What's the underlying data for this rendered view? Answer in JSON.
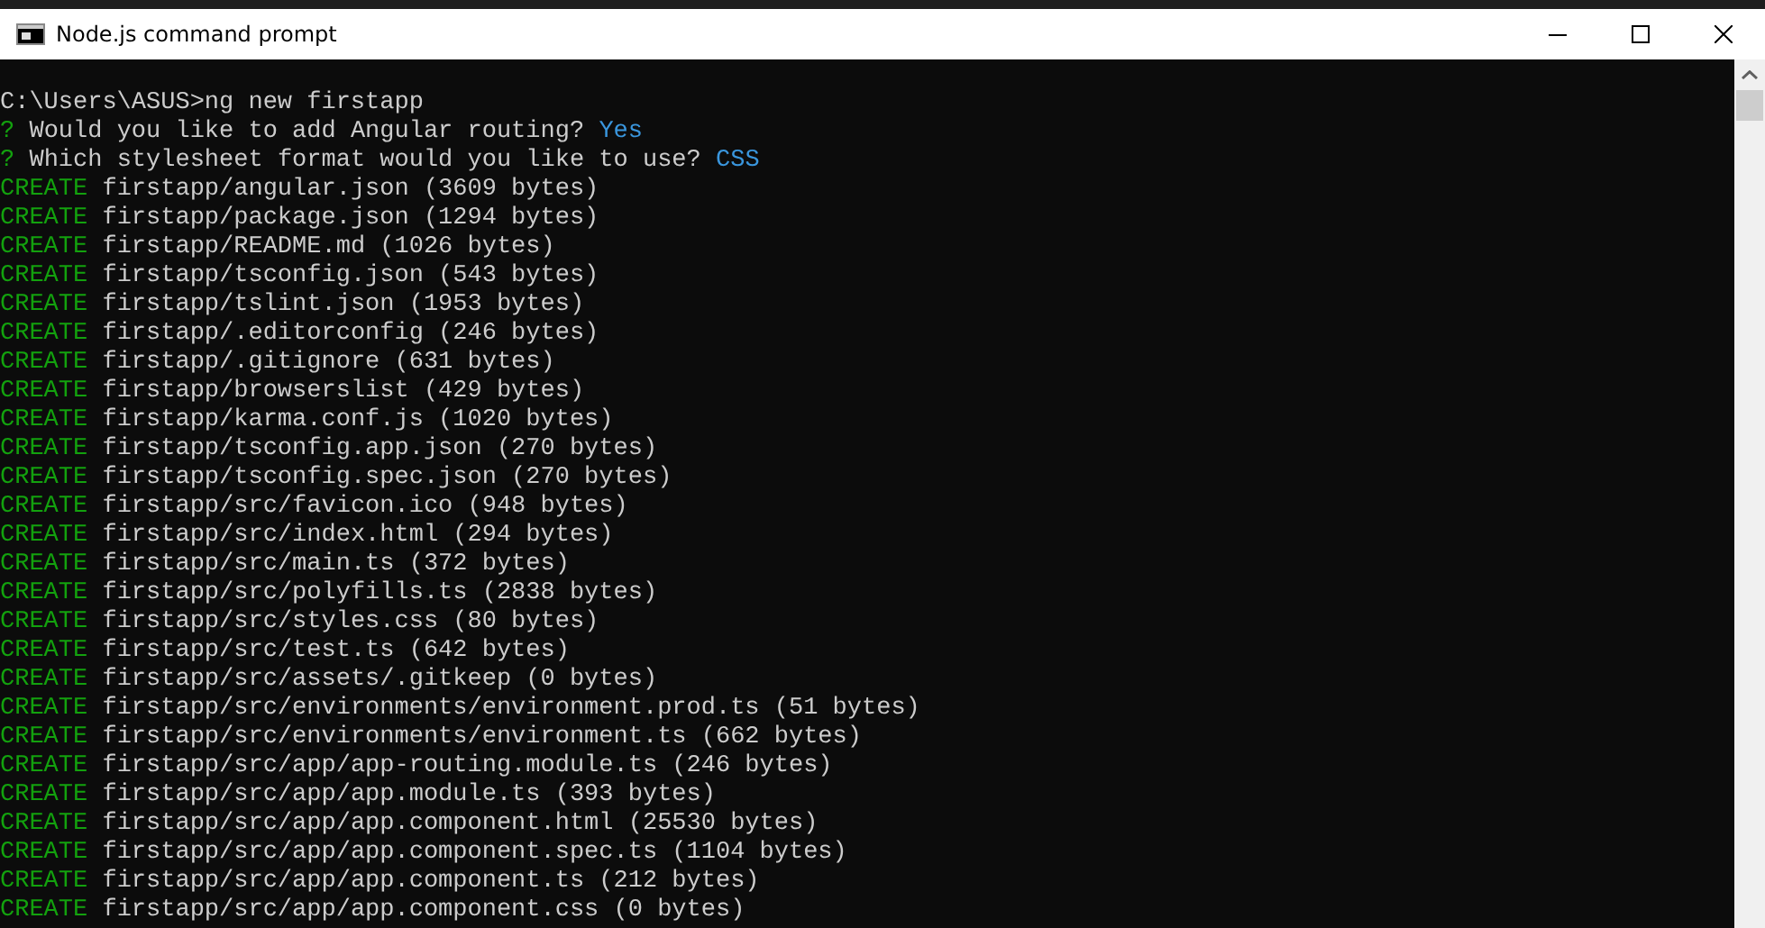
{
  "window": {
    "title": "Node.js command prompt"
  },
  "console": {
    "lines": [
      {
        "kind": "command",
        "text": "C:\\Users\\ASUS>ng new firstapp"
      },
      {
        "kind": "question",
        "mark": "?",
        "text": "Would you like to add Angular routing?",
        "answer": "Yes"
      },
      {
        "kind": "question",
        "mark": "?",
        "text": "Which stylesheet format would you like to use?",
        "answer": "CSS"
      },
      {
        "kind": "create",
        "action": "CREATE",
        "text": "firstapp/angular.json (3609 bytes)"
      },
      {
        "kind": "create",
        "action": "CREATE",
        "text": "firstapp/package.json (1294 bytes)"
      },
      {
        "kind": "create",
        "action": "CREATE",
        "text": "firstapp/README.md (1026 bytes)"
      },
      {
        "kind": "create",
        "action": "CREATE",
        "text": "firstapp/tsconfig.json (543 bytes)"
      },
      {
        "kind": "create",
        "action": "CREATE",
        "text": "firstapp/tslint.json (1953 bytes)"
      },
      {
        "kind": "create",
        "action": "CREATE",
        "text": "firstapp/.editorconfig (246 bytes)"
      },
      {
        "kind": "create",
        "action": "CREATE",
        "text": "firstapp/.gitignore (631 bytes)"
      },
      {
        "kind": "create",
        "action": "CREATE",
        "text": "firstapp/browserslist (429 bytes)"
      },
      {
        "kind": "create",
        "action": "CREATE",
        "text": "firstapp/karma.conf.js (1020 bytes)"
      },
      {
        "kind": "create",
        "action": "CREATE",
        "text": "firstapp/tsconfig.app.json (270 bytes)"
      },
      {
        "kind": "create",
        "action": "CREATE",
        "text": "firstapp/tsconfig.spec.json (270 bytes)"
      },
      {
        "kind": "create",
        "action": "CREATE",
        "text": "firstapp/src/favicon.ico (948 bytes)"
      },
      {
        "kind": "create",
        "action": "CREATE",
        "text": "firstapp/src/index.html (294 bytes)"
      },
      {
        "kind": "create",
        "action": "CREATE",
        "text": "firstapp/src/main.ts (372 bytes)"
      },
      {
        "kind": "create",
        "action": "CREATE",
        "text": "firstapp/src/polyfills.ts (2838 bytes)"
      },
      {
        "kind": "create",
        "action": "CREATE",
        "text": "firstapp/src/styles.css (80 bytes)"
      },
      {
        "kind": "create",
        "action": "CREATE",
        "text": "firstapp/src/test.ts (642 bytes)"
      },
      {
        "kind": "create",
        "action": "CREATE",
        "text": "firstapp/src/assets/.gitkeep (0 bytes)"
      },
      {
        "kind": "create",
        "action": "CREATE",
        "text": "firstapp/src/environments/environment.prod.ts (51 bytes)"
      },
      {
        "kind": "create",
        "action": "CREATE",
        "text": "firstapp/src/environments/environment.ts (662 bytes)"
      },
      {
        "kind": "create",
        "action": "CREATE",
        "text": "firstapp/src/app/app-routing.module.ts (246 bytes)"
      },
      {
        "kind": "create",
        "action": "CREATE",
        "text": "firstapp/src/app/app.module.ts (393 bytes)"
      },
      {
        "kind": "create",
        "action": "CREATE",
        "text": "firstapp/src/app/app.component.html (25530 bytes)"
      },
      {
        "kind": "create",
        "action": "CREATE",
        "text": "firstapp/src/app/app.component.spec.ts (1104 bytes)"
      },
      {
        "kind": "create",
        "action": "CREATE",
        "text": "firstapp/src/app/app.component.ts (212 bytes)"
      },
      {
        "kind": "create",
        "action": "CREATE",
        "text": "firstapp/src/app/app.component.css (0 bytes)"
      }
    ]
  }
}
